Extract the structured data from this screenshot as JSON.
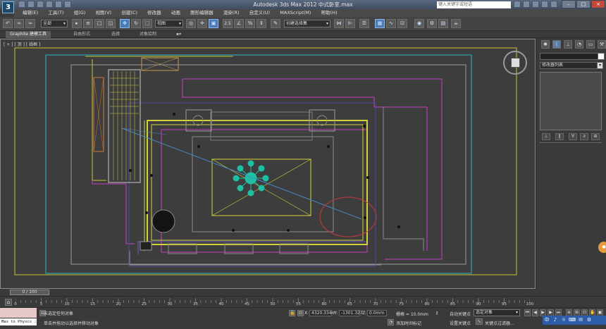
{
  "app": {
    "title": "Autodesk 3ds Max  2012       中式卧室.max",
    "logo_text": "3"
  },
  "search": {
    "placeholder": "键入关键字或短语"
  },
  "window_buttons": [
    "–",
    "□",
    "×"
  ],
  "menu": [
    "编辑(E)",
    "工具(T)",
    "组(G)",
    "视图(V)",
    "创建(C)",
    "修改器",
    "动画",
    "图形编辑器",
    "渲染(R)",
    "自定义(U)",
    "MAXScript(M)",
    "帮助(H)"
  ],
  "toolbar": {
    "filter_select": "全部",
    "view_select": "视图",
    "named_selection": "创建选择集",
    "snap_label": "2.5",
    "angle_label": "%"
  },
  "ribbon": {
    "tabs": [
      "Graphite 建模工具",
      "自由形式",
      "选择",
      "对象绘制"
    ]
  },
  "viewport": {
    "label": "[ + ] [ 顶 ] [ 线框 ]"
  },
  "command_panel": {
    "tab_icons": [
      "create-icon",
      "modify-icon",
      "hierarchy-icon",
      "motion-icon",
      "display-icon",
      "utilities-icon"
    ],
    "modifier_list": "修改器列表",
    "stack_buttons": [
      "⊥",
      "‖",
      "∀",
      "∂",
      "⊞"
    ]
  },
  "time": {
    "slider": "0 / 100",
    "ticks": [
      "0",
      "5",
      "10",
      "15",
      "20",
      "25",
      "30",
      "35",
      "40",
      "45",
      "50",
      "55",
      "60",
      "65",
      "70",
      "75",
      "80",
      "85",
      "90",
      "95",
      "100"
    ]
  },
  "status": {
    "maxscript_line": "Max to Physcs :",
    "selection_status": "未选定任何对象",
    "prompt": "单击并拖动以选择并移动对象",
    "x_label": "X:",
    "x_value": "4320.334m",
    "y_label": "Y:",
    "y_value": "-1301.327",
    "z_label": "Z:",
    "z_value": "0.0mm",
    "grid": "栅格 = 10.0mm",
    "add_time_tag": "添加时间标记",
    "auto_key": "自动关键点",
    "set_key": "设置关键点",
    "key_mode": "选定对象",
    "key_filters": "关键点过滤器..."
  },
  "tray": [
    "中",
    "♪",
    "☼",
    "⌨",
    "✉",
    "⚙"
  ],
  "colors": {
    "viewport_bg": "#3d3d3d",
    "lamp": "#1fbfa3",
    "selection_circle": "#c53a3a"
  }
}
